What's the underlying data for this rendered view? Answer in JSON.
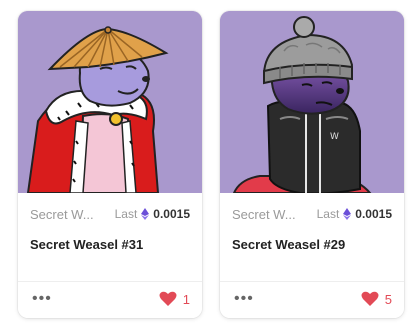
{
  "cards": [
    {
      "collection": "Secret W...",
      "last_label": "Last",
      "price": "0.0015",
      "name": "Secret Weasel #31",
      "likes": "1",
      "more": "•••",
      "art_bg": "#a998cd",
      "currency_icon": "eth-icon",
      "like_icon": "heart-icon"
    },
    {
      "collection": "Secret W...",
      "last_label": "Last",
      "price": "0.0015",
      "name": "Secret Weasel #29",
      "likes": "5",
      "more": "•••",
      "art_bg": "#a998cd",
      "currency_icon": "eth-icon",
      "like_icon": "heart-icon"
    }
  ],
  "colors": {
    "accent_heart": "#e24a56",
    "eth": "#6b4fd8",
    "muted_text": "#9a9a9a"
  }
}
